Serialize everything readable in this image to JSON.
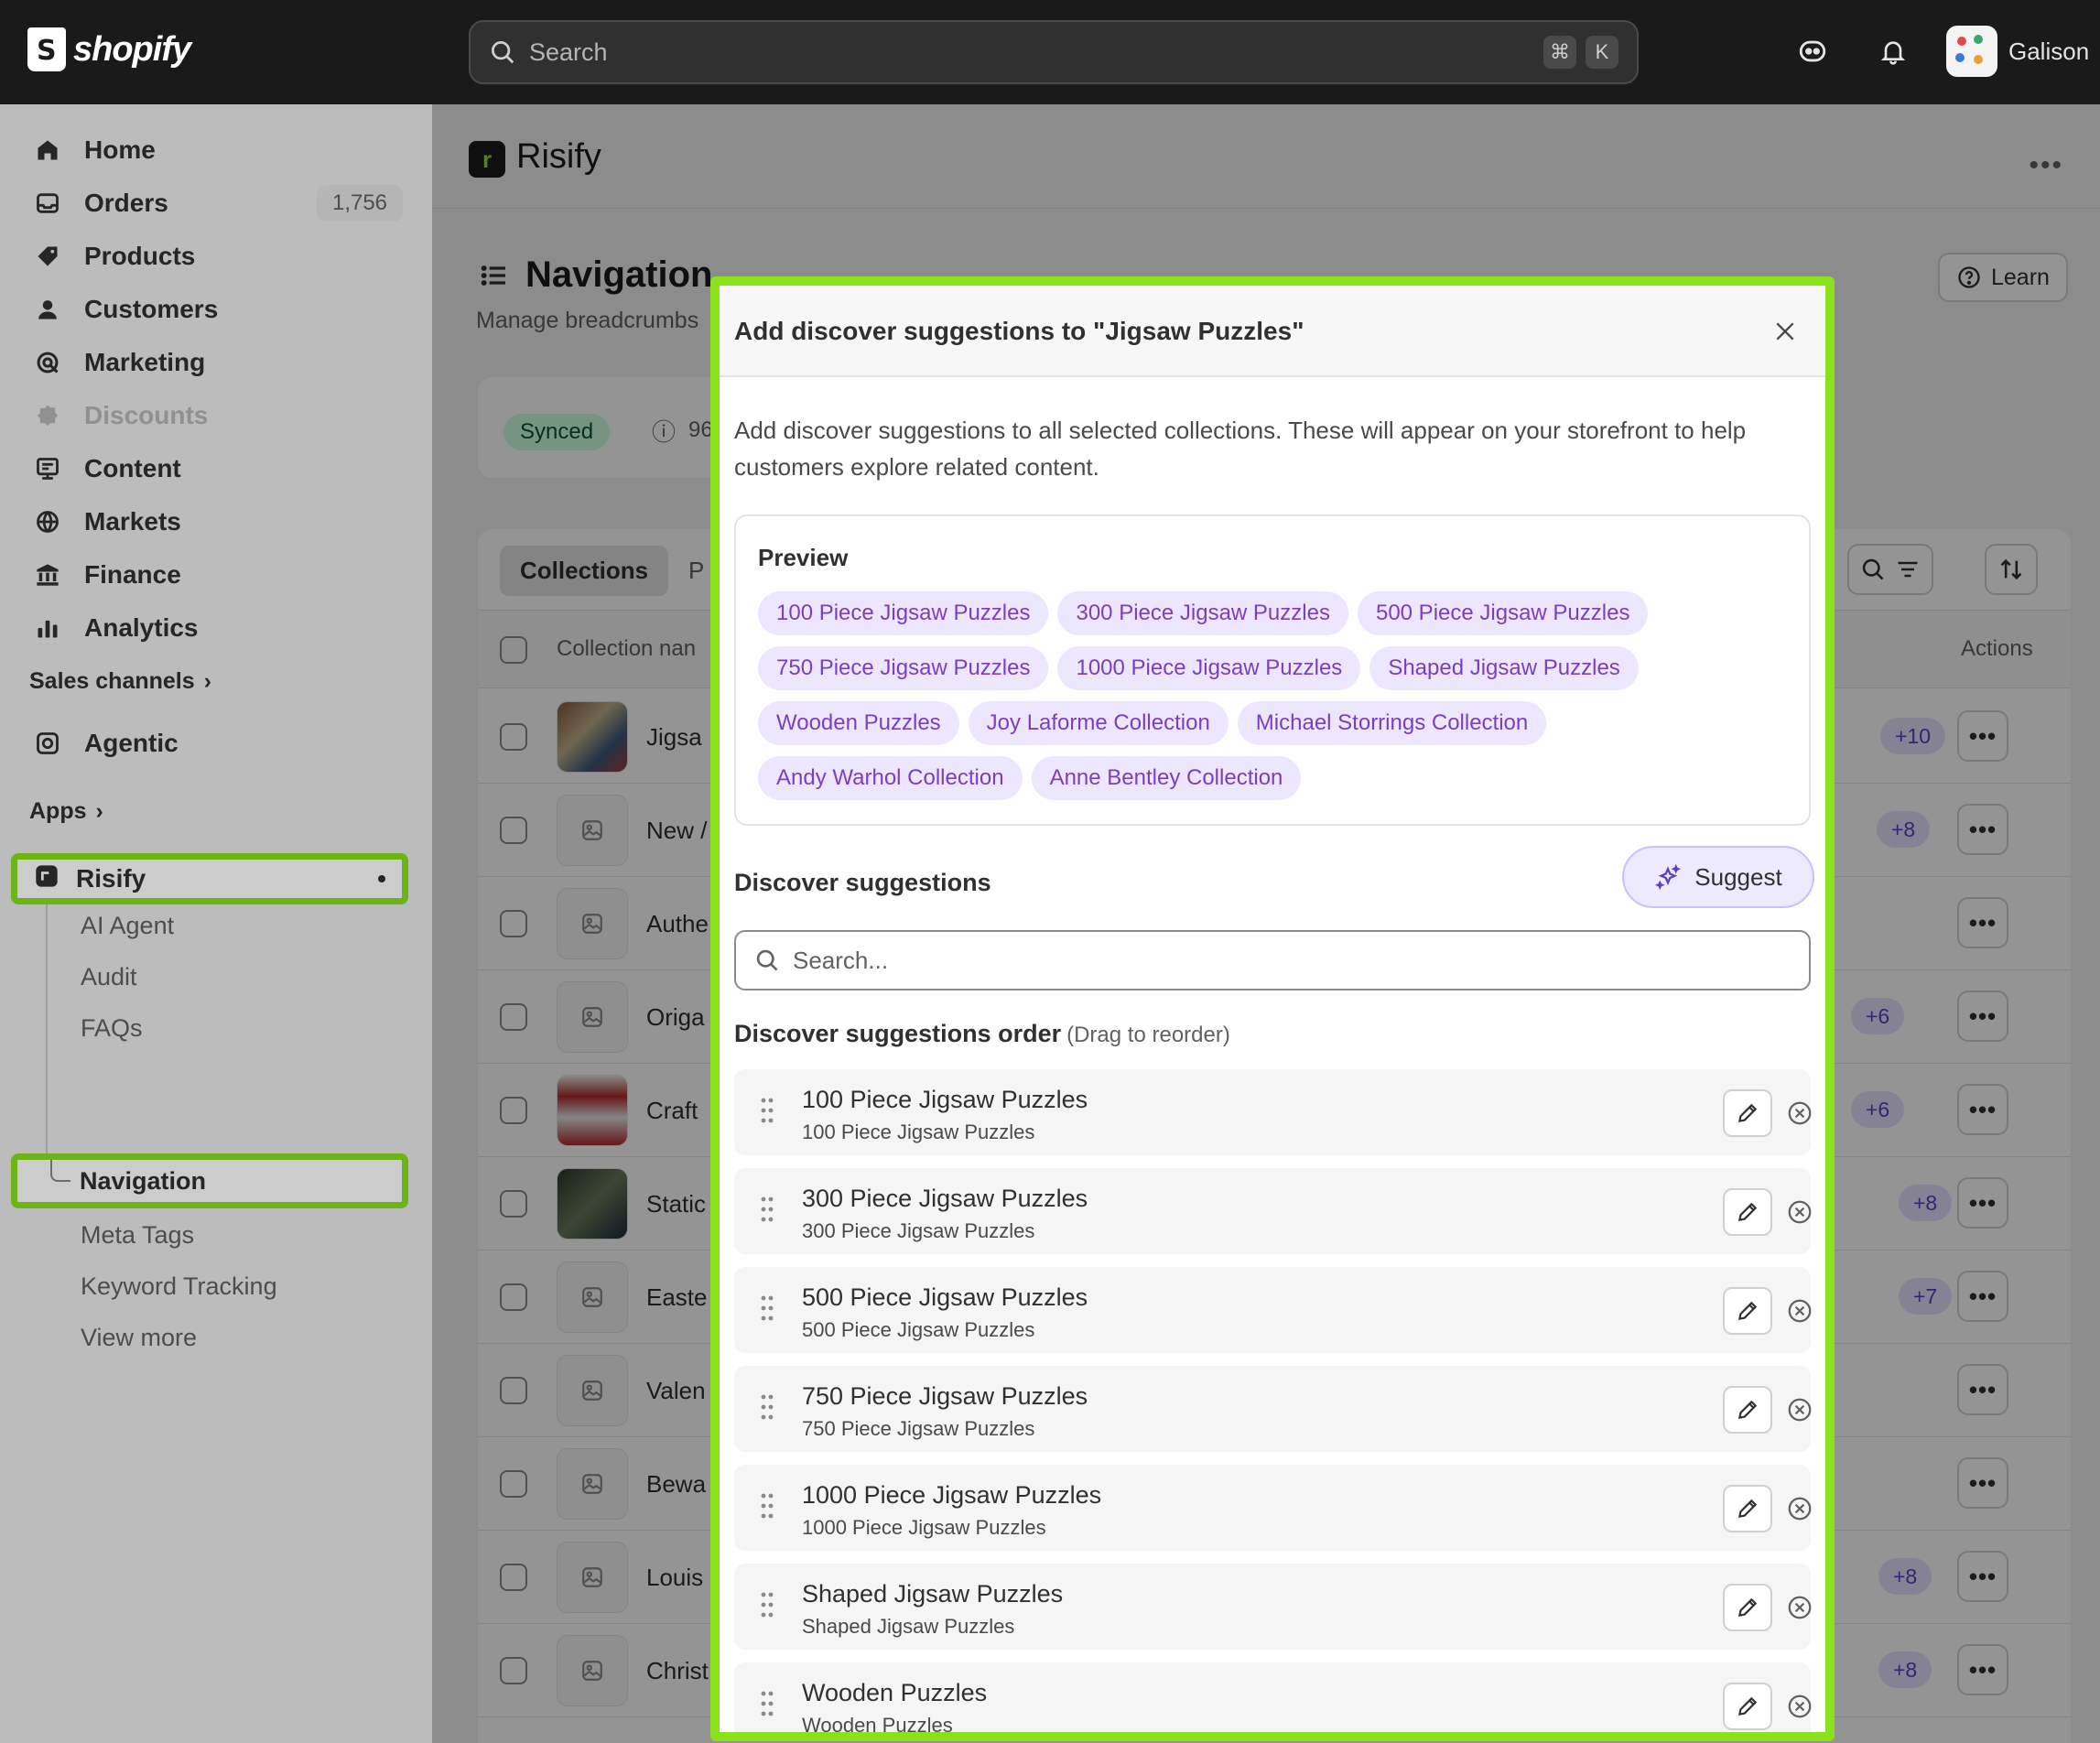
{
  "topbar": {
    "brand": "shopify",
    "search_placeholder": "Search",
    "shortcut_keys": [
      "⌘",
      "K"
    ],
    "account_name": "Galison"
  },
  "sidebar": {
    "items": [
      {
        "label": "Home",
        "icon": "home-icon"
      },
      {
        "label": "Orders",
        "icon": "orders-icon",
        "count": "1,756"
      },
      {
        "label": "Products",
        "icon": "tag-icon"
      },
      {
        "label": "Customers",
        "icon": "person-icon"
      },
      {
        "label": "Marketing",
        "icon": "target-icon"
      },
      {
        "label": "Discounts",
        "icon": "discount-icon",
        "disabled": true
      },
      {
        "label": "Content",
        "icon": "content-icon"
      },
      {
        "label": "Markets",
        "icon": "globe-icon"
      },
      {
        "label": "Finance",
        "icon": "bank-icon"
      },
      {
        "label": "Analytics",
        "icon": "bar-chart-icon"
      }
    ],
    "sales_channels_label": "Sales channels",
    "agentic_label": "Agentic",
    "apps_label": "Apps",
    "app_name": "Risify",
    "app_subitems": [
      "AI Agent",
      "Audit",
      "FAQs"
    ],
    "active_subitem": "Navigation",
    "more_subitems": [
      "Meta Tags",
      "Keyword Tracking",
      "View more"
    ]
  },
  "app": {
    "name": "Risify",
    "page_title": "Navigation",
    "page_subtitle": "Manage breadcrumbs",
    "learn_label": "Learn",
    "status_badge": "Synced",
    "status_count": "96",
    "tabs": [
      "Collections",
      "P"
    ],
    "col_name_header": "Collection nan",
    "col_actions_header": "Actions",
    "rows": [
      {
        "name": "Jigsa",
        "extra": "+10"
      },
      {
        "name": "New /",
        "extra": "+8"
      },
      {
        "name": "Authe",
        "extra": ""
      },
      {
        "name": "Origa",
        "extra": "+6"
      },
      {
        "name": "Craft",
        "extra": "+6"
      },
      {
        "name": "Static",
        "extra": "+8"
      },
      {
        "name": "Easte",
        "extra": "+7"
      },
      {
        "name": "Valen",
        "extra": ""
      },
      {
        "name": "Bewa",
        "extra": ""
      },
      {
        "name": "Louis",
        "extra": "+8"
      },
      {
        "name": "Christ",
        "extra": "+8"
      }
    ]
  },
  "modal": {
    "title": "Add discover suggestions to \"Jigsaw Puzzles\"",
    "description": "Add discover suggestions to all selected collections. These will appear on your storefront to help customers explore related content.",
    "preview_label": "Preview",
    "preview_tags": [
      "100 Piece Jigsaw Puzzles",
      "300 Piece Jigsaw Puzzles",
      "500 Piece Jigsaw Puzzles",
      "750 Piece Jigsaw Puzzles",
      "1000 Piece Jigsaw Puzzles",
      "Shaped Jigsaw Puzzles",
      "Wooden Puzzles",
      "Joy Laforme Collection",
      "Michael Storrings Collection",
      "Andy Warhol Collection",
      "Anne Bentley Collection"
    ],
    "suggestions_label": "Discover suggestions",
    "suggest_button": "Suggest",
    "search_placeholder": "Search...",
    "order_label": "Discover suggestions order",
    "order_hint": "(Drag to reorder)",
    "order_items": [
      {
        "title": "100 Piece Jigsaw Puzzles",
        "subtitle": "100 Piece Jigsaw Puzzles"
      },
      {
        "title": "300 Piece Jigsaw Puzzles",
        "subtitle": "300 Piece Jigsaw Puzzles"
      },
      {
        "title": "500 Piece Jigsaw Puzzles",
        "subtitle": "500 Piece Jigsaw Puzzles"
      },
      {
        "title": "750 Piece Jigsaw Puzzles",
        "subtitle": "750 Piece Jigsaw Puzzles"
      },
      {
        "title": "1000 Piece Jigsaw Puzzles",
        "subtitle": "1000 Piece Jigsaw Puzzles"
      },
      {
        "title": "Shaped Jigsaw Puzzles",
        "subtitle": "Shaped Jigsaw Puzzles"
      },
      {
        "title": "Wooden Puzzles",
        "subtitle": "Wooden Puzzles"
      }
    ]
  },
  "colors": {
    "highlight": "#8be21b",
    "tag_bg": "#ede6ff",
    "tag_text": "#7b3fbe",
    "topbar": "#1a1a1a"
  }
}
